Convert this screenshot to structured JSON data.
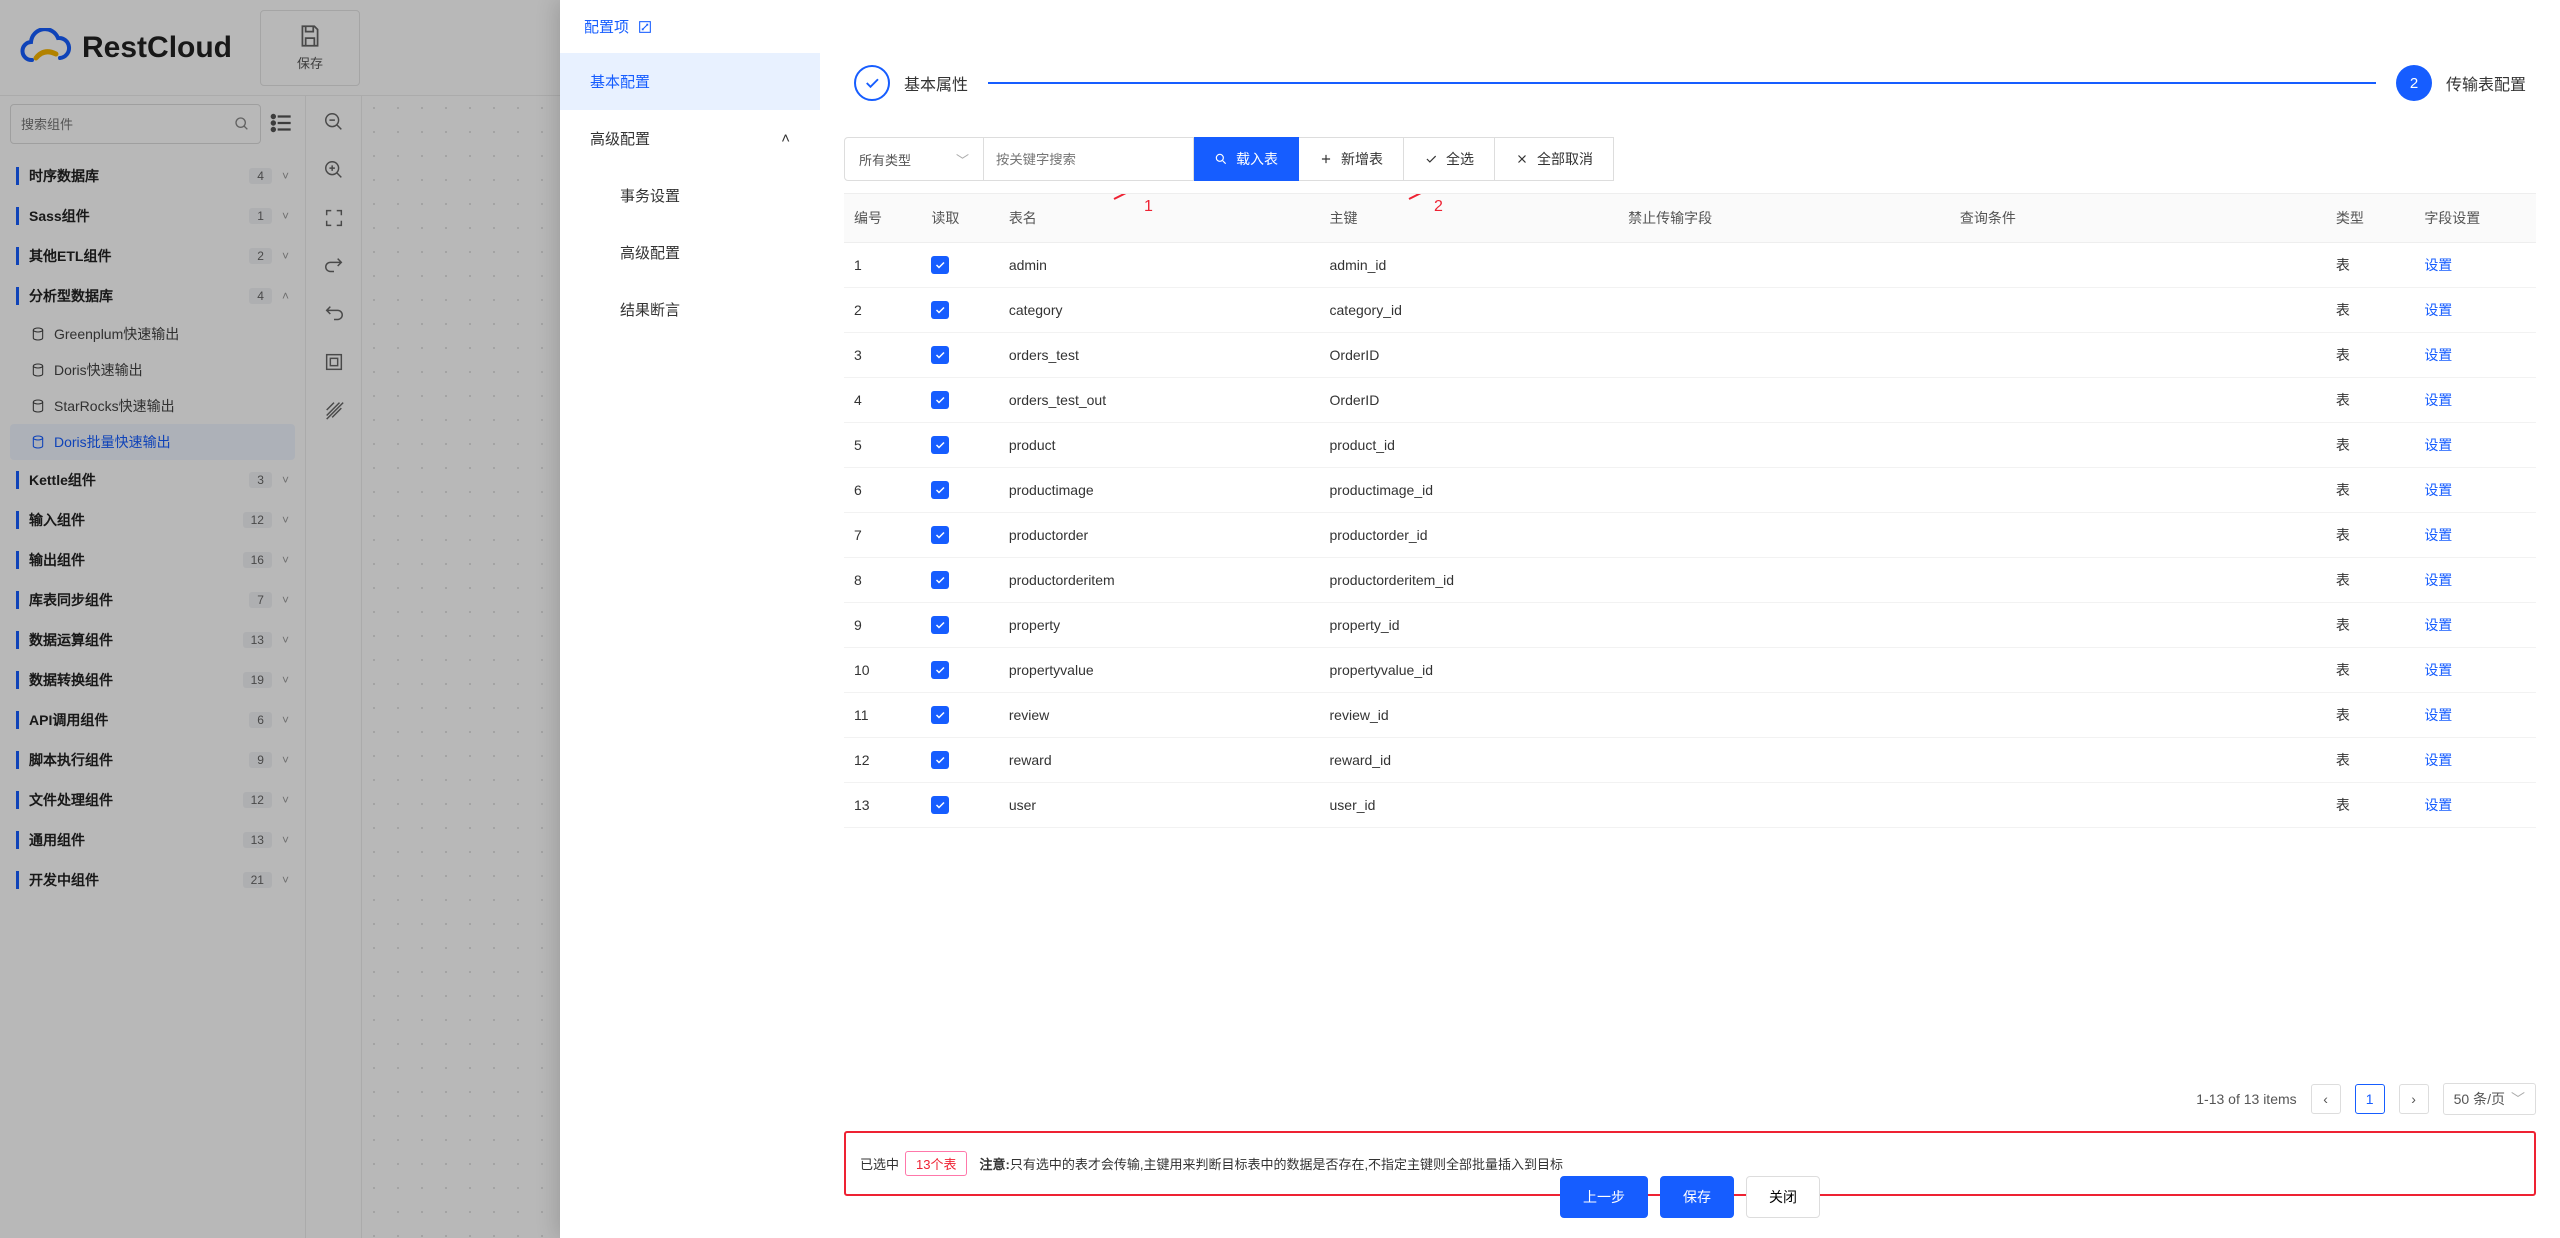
{
  "brand": {
    "name": "RestCloud"
  },
  "top": {
    "save": "保存"
  },
  "search": {
    "placeholder": "搜索组件"
  },
  "tree": [
    {
      "label": "时序数据库",
      "count": "4",
      "open": false
    },
    {
      "label": "Sass组件",
      "count": "1",
      "open": false
    },
    {
      "label": "其他ETL组件",
      "count": "2",
      "open": false
    },
    {
      "label": "分析型数据库",
      "count": "4",
      "open": true,
      "children": [
        {
          "label": "Greenplum快速输出"
        },
        {
          "label": "Doris快速输出"
        },
        {
          "label": "StarRocks快速输出"
        },
        {
          "label": "Doris批量快速输出",
          "active": true
        }
      ]
    },
    {
      "label": "Kettle组件",
      "count": "3",
      "open": false
    },
    {
      "label": "输入组件",
      "count": "12",
      "open": false
    },
    {
      "label": "输出组件",
      "count": "16",
      "open": false
    },
    {
      "label": "库表同步组件",
      "count": "7",
      "open": false
    },
    {
      "label": "数据运算组件",
      "count": "13",
      "open": false
    },
    {
      "label": "数据转换组件",
      "count": "19",
      "open": false
    },
    {
      "label": "API调用组件",
      "count": "6",
      "open": false
    },
    {
      "label": "脚本执行组件",
      "count": "9",
      "open": false
    },
    {
      "label": "文件处理组件",
      "count": "12",
      "open": false
    },
    {
      "label": "通用组件",
      "count": "13",
      "open": false
    },
    {
      "label": "开发中组件",
      "count": "21",
      "open": false
    }
  ],
  "modal": {
    "title": "配置项",
    "nav": {
      "basic": "基本配置",
      "advanced": "高级配置",
      "tx": "事务设置",
      "adv2": "高级配置",
      "assert": "结果断言"
    },
    "steps": {
      "s1": "基本属性",
      "s2num": "2",
      "s2": "传输表配置"
    },
    "toolbar": {
      "all_types": "所有类型",
      "kw_placeholder": "按关键字搜索",
      "load": "载入表",
      "add": "新增表",
      "select_all": "全选",
      "cancel_all": "全部取消"
    },
    "columns": {
      "idx": "编号",
      "read": "读取",
      "name": "表名",
      "pk": "主键",
      "forbid": "禁止传输字段",
      "cond": "查询条件",
      "type": "类型",
      "field": "字段设置"
    },
    "rows": [
      {
        "idx": "1",
        "name": "admin",
        "pk": "admin_id",
        "type": "表"
      },
      {
        "idx": "2",
        "name": "category",
        "pk": "category_id",
        "type": "表"
      },
      {
        "idx": "3",
        "name": "orders_test",
        "pk": "OrderID",
        "type": "表"
      },
      {
        "idx": "4",
        "name": "orders_test_out",
        "pk": "OrderID",
        "type": "表"
      },
      {
        "idx": "5",
        "name": "product",
        "pk": "product_id",
        "type": "表"
      },
      {
        "idx": "6",
        "name": "productimage",
        "pk": "productimage_id",
        "type": "表"
      },
      {
        "idx": "7",
        "name": "productorder",
        "pk": "productorder_id",
        "type": "表"
      },
      {
        "idx": "8",
        "name": "productorderitem",
        "pk": "productorderitem_id",
        "type": "表"
      },
      {
        "idx": "9",
        "name": "property",
        "pk": "property_id",
        "type": "表"
      },
      {
        "idx": "10",
        "name": "propertyvalue",
        "pk": "propertyvalue_id",
        "type": "表"
      },
      {
        "idx": "11",
        "name": "review",
        "pk": "review_id",
        "type": "表"
      },
      {
        "idx": "12",
        "name": "reward",
        "pk": "reward_id",
        "type": "表"
      },
      {
        "idx": "13",
        "name": "user",
        "pk": "user_id",
        "type": "表"
      }
    ],
    "row_action": "设置",
    "pager": {
      "range": "1-13 of 13 items",
      "page": "1",
      "size": "50 条/页"
    },
    "notice": {
      "prefix": "已选中",
      "count": "13个表",
      "bold": "注意:",
      "text": "只有选中的表才会传输,主键用来判断目标表中的数据是否存在,不指定主键则全部批量插入到目标"
    },
    "footer": {
      "prev": "上一步",
      "save": "保存",
      "close": "关闭"
    },
    "annot": {
      "n1": "1",
      "n2": "2"
    }
  }
}
